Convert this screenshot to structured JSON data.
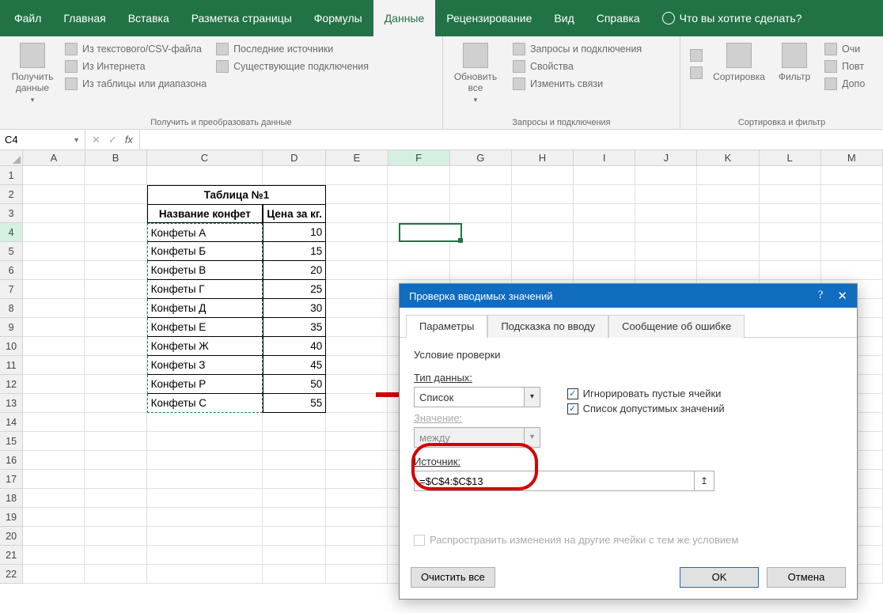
{
  "tabs": {
    "file": "Файл",
    "home": "Главная",
    "insert": "Вставка",
    "pagelayout": "Разметка страницы",
    "formulas": "Формулы",
    "data": "Данные",
    "review": "Рецензирование",
    "view": "Вид",
    "help": "Справка",
    "tellme": "Что вы хотите сделать?"
  },
  "ribbon": {
    "get": {
      "big": "Получить\nданные",
      "csv": "Из текстового/CSV-файла",
      "web": "Из Интернета",
      "range": "Из таблицы или диапазона",
      "recent": "Последние источники",
      "conn": "Существующие подключения",
      "label": "Получить и преобразовать данные"
    },
    "refresh": {
      "big": "Обновить\nвсе",
      "queries": "Запросы и подключения",
      "props": "Свойства",
      "links": "Изменить связи",
      "label": "Запросы и подключения"
    },
    "sort": {
      "sort": "Сортировка",
      "filter": "Фильтр",
      "clear": "Очи",
      "reapply": "Повт",
      "adv": "Допо",
      "label": "Сортировка и фильтр"
    }
  },
  "namebox": "C4",
  "columns": [
    "A",
    "B",
    "C",
    "D",
    "E",
    "F",
    "G",
    "H",
    "I",
    "J",
    "K",
    "L",
    "M"
  ],
  "rownums": [
    1,
    2,
    3,
    4,
    5,
    6,
    7,
    8,
    9,
    10,
    11,
    12,
    13,
    14,
    15,
    16,
    17,
    18,
    19,
    20,
    21,
    22
  ],
  "table": {
    "title": "Таблица №1",
    "h1": "Название конфет",
    "h2": "Цена за кг.",
    "rows": [
      {
        "n": "Конфеты А",
        "p": "10"
      },
      {
        "n": "Конфеты Б",
        "p": "15"
      },
      {
        "n": "Конфеты В",
        "p": "20"
      },
      {
        "n": "Конфеты Г",
        "p": "25"
      },
      {
        "n": "Конфеты Д",
        "p": "30"
      },
      {
        "n": "Конфеты Е",
        "p": "35"
      },
      {
        "n": "Конфеты Ж",
        "p": "40"
      },
      {
        "n": "Конфеты З",
        "p": "45"
      },
      {
        "n": "Конфеты Р",
        "p": "50"
      },
      {
        "n": "Конфеты С",
        "p": "55"
      }
    ]
  },
  "dialog": {
    "title": "Проверка вводимых значений",
    "tabs": {
      "params": "Параметры",
      "input": "Подсказка по вводу",
      "error": "Сообщение об ошибке"
    },
    "cond": "Условие проверки",
    "typelabel": "Тип данных:",
    "typeval": "Список",
    "ignore": "Игнорировать пустые ячейки",
    "dropdown": "Список допустимых значений",
    "valuelabel": "Значение:",
    "valueval": "между",
    "sourcelabel": "Источник:",
    "sourceval": "=$C$4:$C$13",
    "propagate": "Распространить изменения на другие ячейки с тем же условием",
    "clear": "Очистить все",
    "ok": "OK",
    "cancel": "Отмена"
  }
}
